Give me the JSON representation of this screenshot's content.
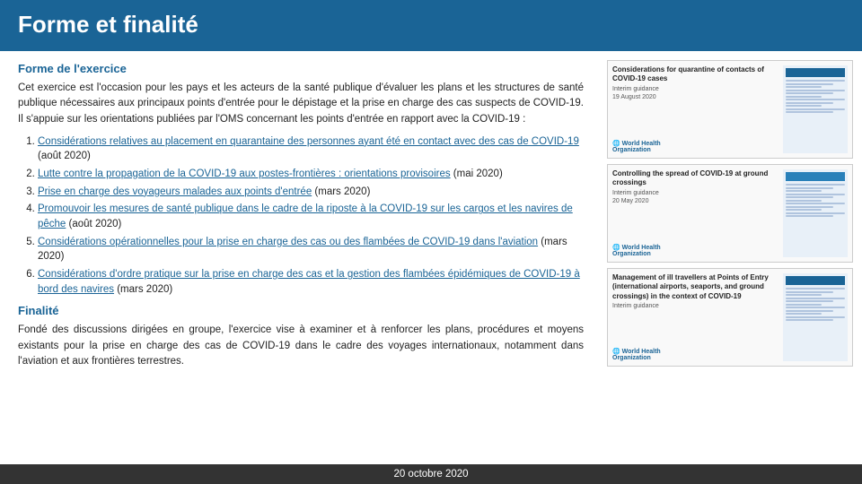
{
  "header": {
    "title": "Forme et finalité"
  },
  "main": {
    "section1_title": "Forme de l'exercice",
    "section1_body": "Cet exercice est l'occasion pour les pays et les acteurs de la santé publique d'évaluer les plans et les structures de santé publique nécessaires aux principaux points d'entrée pour le dépistage et la prise en charge des cas suspects de COVID-19. Il s'appuie sur les orientations publiées par l'OMS concernant les points d'entrée en rapport avec la COVID-19 :",
    "list_items": [
      {
        "link_text": "Considérations relatives au placement en quarantaine des personnes ayant été en contact avec des cas de COVID-19",
        "suffix": " (août 2020)"
      },
      {
        "link_text": "Lutte contre la propagation de la COVID-19 aux postes-frontières : orientations provisoires",
        "suffix": " (mai 2020)"
      },
      {
        "link_text": "Prise en charge des voyageurs malades aux points d'entrée",
        "suffix": " (mars 2020)"
      },
      {
        "link_text": "Promouvoir les mesures de santé publique dans le cadre de la riposte à la COVID-19 sur les cargos et les navires de pêche",
        "suffix": " (août 2020)"
      },
      {
        "link_text": "Considérations opérationnelles pour la prise en charge des cas ou des flambées de COVID-19 dans l'aviation",
        "suffix": " (mars 2020)"
      },
      {
        "link_text": "Considérations d'ordre pratique sur la prise en charge des cas et la gestion des flambées épidémiques de COVID-19 à bord des navires",
        "suffix": " (mars 2020)"
      }
    ],
    "section2_title": "Finalité",
    "section2_body": "Fondé des discussions dirigées en groupe, l'exercice vise à examiner et à renforcer les plans, procédures et moyens existants pour la prise en charge des cas de COVID-19 dans le cadre des voyages internationaux, notamment dans l'aviation et aux frontières terrestres."
  },
  "docs": [
    {
      "title": "Considerations for quarantine of contacts of COVID-19 cases",
      "subtitle": "Interim guidance",
      "date": "19 August 2020"
    },
    {
      "title": "Controlling the spread of COVID-19 at ground crossings",
      "subtitle": "Interim guidance",
      "date": "20 May 2020"
    },
    {
      "title": "Management of ill travellers at Points of Entry (international airports, seaports, and ground crossings) in the context of COVID-19",
      "subtitle": "Interim guidance",
      "date": ""
    }
  ],
  "footer": {
    "date": "20 octobre 2020"
  }
}
